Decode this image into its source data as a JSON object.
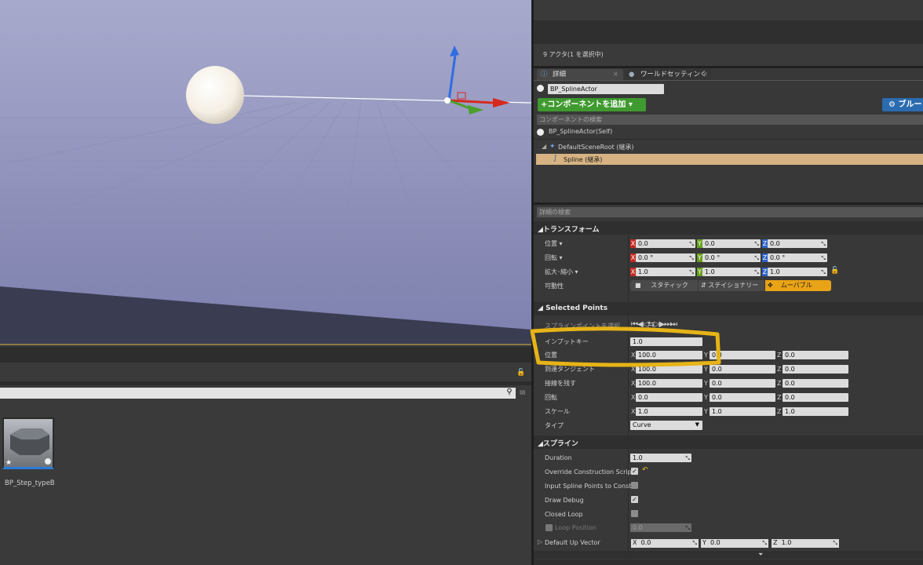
{
  "actor_count": "9 アクタ(1 を選択中)",
  "tabs": {
    "details": "詳細",
    "world_settings": "ワールドセッティンく"
  },
  "actor_name": "BP_SplineActor",
  "add_component": "+コンポーネントを追加 ▾",
  "blueprint_button": "ブルー",
  "component_search_placeholder": "コンポーネントの検索",
  "tree": {
    "self": "BP_SplineActor(Self)",
    "root": "DefaultSceneRoot (継承)",
    "spline": "Spline (継承)"
  },
  "details_search_placeholder": "詳細の検索",
  "transform": {
    "section": "トランスフォーム",
    "location_label": "位置 ▾",
    "rotation_label": "回転 ▾",
    "scale_label": "拡大･縮小 ▾",
    "mobility_label": "可動性",
    "location": [
      "0.0",
      "0.0",
      "0.0"
    ],
    "rotation": [
      "0.0 °",
      "0.0 °",
      "0.0 °"
    ],
    "scale": [
      "1.0",
      "1.0",
      "1.0"
    ],
    "mobility_options": [
      "スタティック",
      "ステイショナリー",
      "ムーバブル"
    ],
    "accent_color": "#e8a316"
  },
  "selected_points": {
    "section": "Selected Points",
    "select_label": "スプラインポイントを選択",
    "input_key_label": "インプットキー",
    "input_key": "1.0",
    "position_label": "位置",
    "position": [
      "100.0",
      "0.0",
      "0.0"
    ],
    "arrive_label": "到達タンジェント",
    "arrive": [
      "100.0",
      "0.0",
      "0.0"
    ],
    "leave_label": "接線を残す",
    "leave": [
      "100.0",
      "0.0",
      "0.0"
    ],
    "rotation_label": "回転",
    "rotation": [
      "0.0",
      "0.0",
      "0.0"
    ],
    "scale_label": "スケール",
    "scale": [
      "1.0",
      "1.0",
      "1.0"
    ],
    "type_label": "タイプ",
    "type_value": "Curve"
  },
  "spline": {
    "section": "スプライン",
    "duration_label": "Duration",
    "duration": "1.0",
    "override_label": "Override Construction Script",
    "input_points_label": "Input Spline Points to Constr",
    "draw_debug_label": "Draw Debug",
    "closed_loop_label": "Closed Loop",
    "loop_position_label": "Loop Position",
    "loop_position": "0.0",
    "up_vector_label": "Default Up Vector",
    "up_vector": [
      "0.0",
      "0.0",
      "1.0"
    ]
  },
  "axis_letters": [
    "X",
    "Y",
    "Z"
  ],
  "content_browser": {
    "asset_name": "BP_Step_typeB"
  },
  "highlight_color": "#e6b417"
}
